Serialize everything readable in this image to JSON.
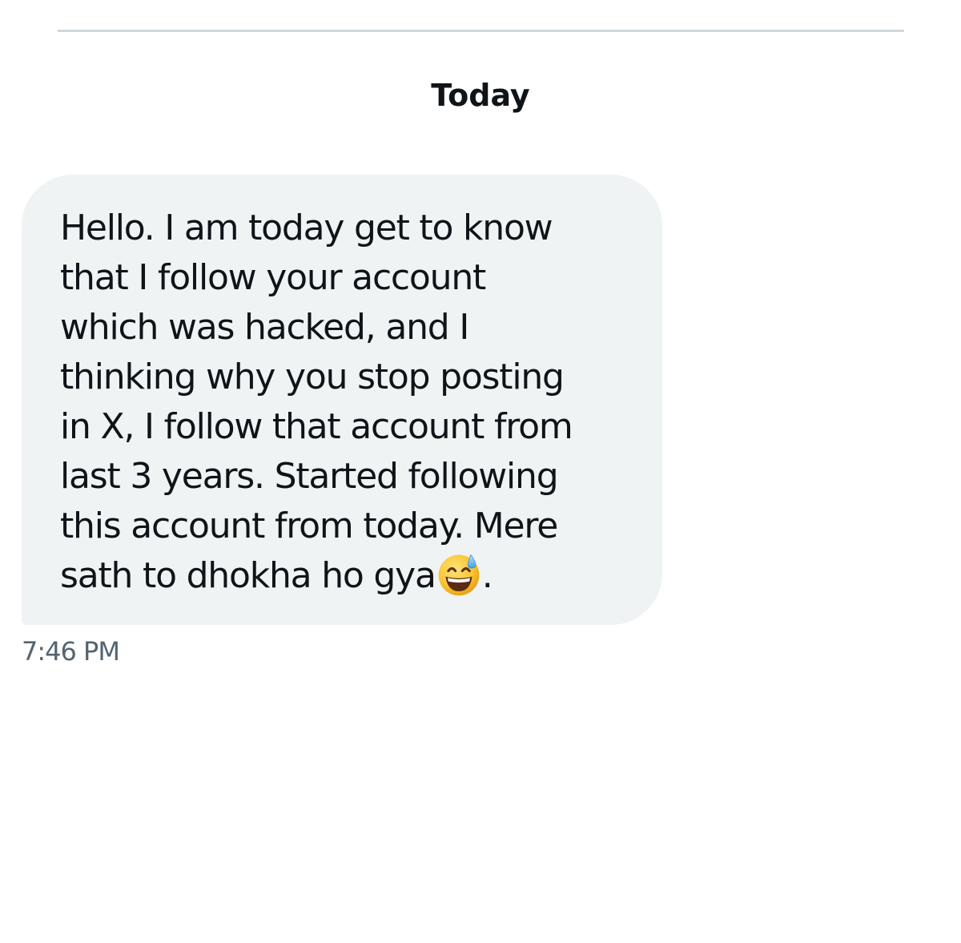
{
  "date_separator": {
    "label": "Today"
  },
  "message": {
    "lines": [
      "Hello. I am today get to know",
      "that I follow your account",
      "which was hacked, and I",
      "thinking why you stop posting",
      "in X, I follow that account from",
      "last 3 years. Started following",
      "this account from today. Mere"
    ],
    "last_line_before_emoji": "sath to dhokha ho gya",
    "emoji": "grinning-face-with-sweat-icon",
    "last_line_after_emoji": ".",
    "timestamp": "7:46 PM"
  },
  "colors": {
    "bubble_background": "#eff3f4",
    "text_primary": "#0f1419",
    "text_secondary": "#536471",
    "divider": "#cfd9de"
  }
}
